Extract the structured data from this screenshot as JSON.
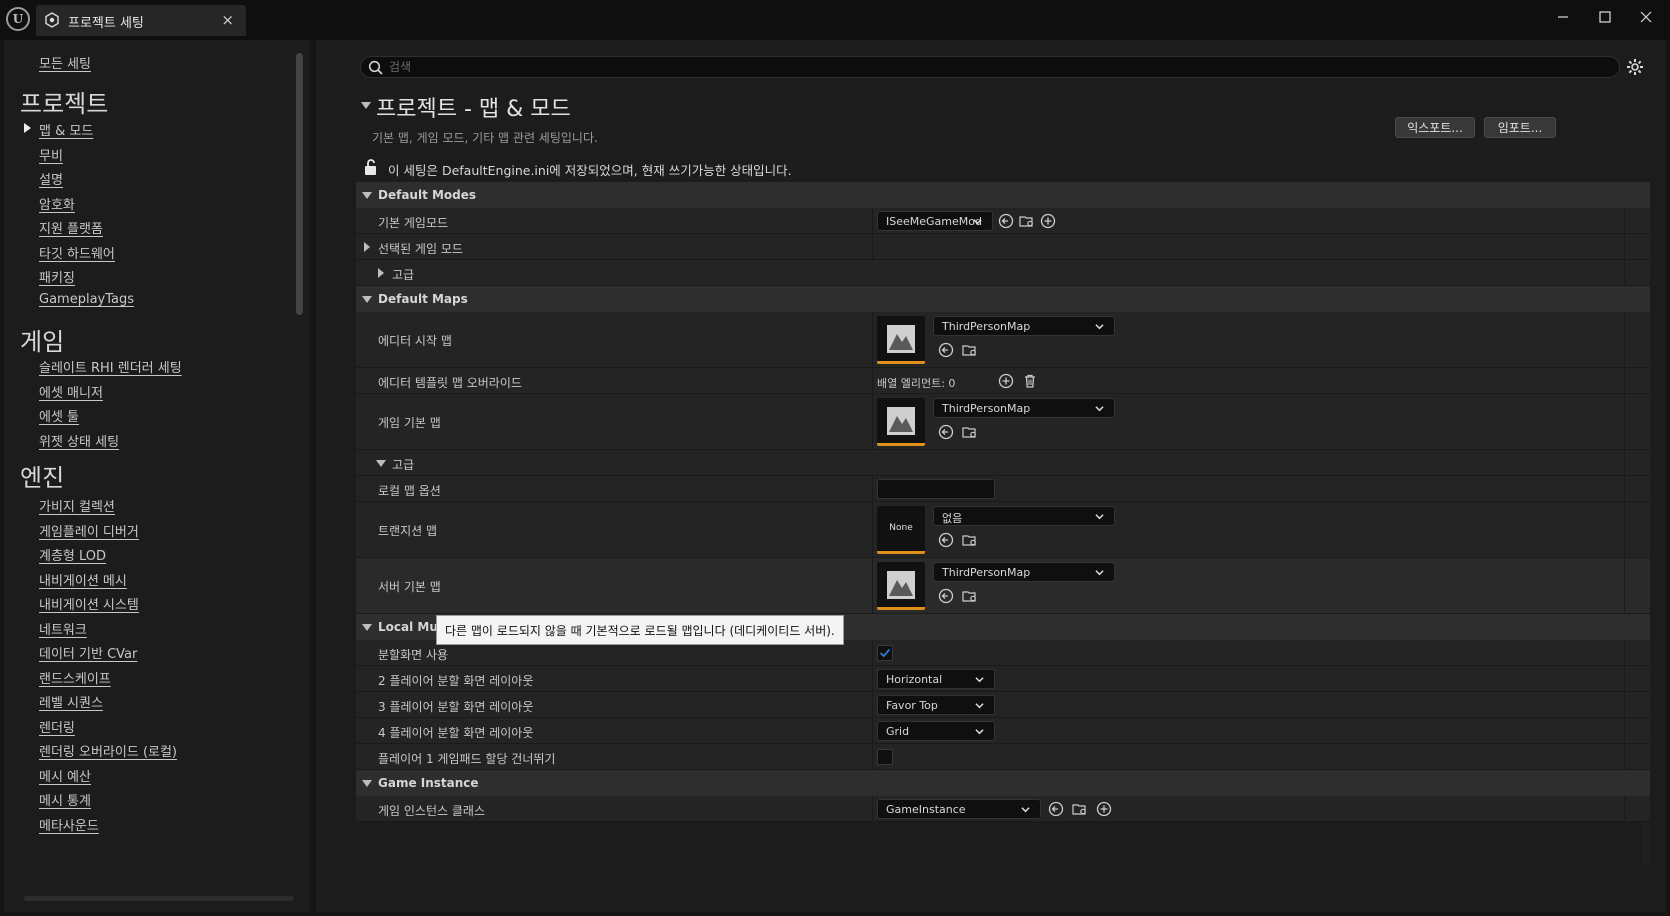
{
  "window": {
    "tab_title": "프로젝트 세팅",
    "tab_close": "×"
  },
  "sidebar": {
    "all_settings": "모든 세팅",
    "categories": [
      {
        "title": "프로젝트",
        "items": [
          "맵 & 모드",
          "무비",
          "설명",
          "암호화",
          "지원 플랫폼",
          "타깃 하드웨어",
          "패키징",
          "GameplayTags"
        ]
      },
      {
        "title": "게임",
        "items": [
          "슬레이트 RHI 렌더러 세팅",
          "에셋 매니저",
          "에셋 툴",
          "위젯 상태 세팅"
        ]
      },
      {
        "title": "엔진",
        "items": [
          "가비지 컬렉션",
          "게임플레이 디버거",
          "계층형 LOD",
          "내비게이션 메시",
          "내비게이션 시스템",
          "네트워크",
          "데이터 기반 CVar",
          "랜드스케이프",
          "레벨 시퀀스",
          "렌더링",
          "렌더링 오버라이드 (로컬)",
          "메시 예산",
          "메시 통계",
          "메타사운드"
        ]
      }
    ],
    "selected": "맵 & 모드"
  },
  "search": {
    "placeholder": "검색",
    "value": ""
  },
  "header": {
    "title": "프로젝트 - 맵 & 모드",
    "description": "기본 맵, 게임 모드, 기타 맵 관련 세팅입니다.",
    "export_label": "익스포트...",
    "import_label": "임포트...",
    "lock_notice": "이 세팅은 DefaultEngine.ini에 저장되었으며, 현재 쓰기가능한 상태입니다."
  },
  "sections": {
    "default_modes": {
      "title": "Default Modes",
      "default_gamemode_label": "기본 게임모드",
      "default_gamemode_value": "ISeeMeGameMod",
      "selected_gamemode_label": "선택된 게임 모드",
      "advanced_label": "고급"
    },
    "default_maps": {
      "title": "Default Maps",
      "editor_startup_label": "에디터 시작 맵",
      "editor_startup_value": "ThirdPersonMap",
      "editor_template_label": "에디터 템플릿 맵 오버라이드",
      "array_elements": "배열 엘리먼트: 0",
      "game_default_label": "게임 기본 맵",
      "game_default_value": "ThirdPersonMap",
      "advanced_label": "고급",
      "local_map_options_label": "로컬 맵 옵션",
      "local_map_options_value": "",
      "transition_map_label": "트랜지션 맵",
      "transition_map_value": "없음",
      "transition_thumb_text": "None",
      "server_default_label": "서버 기본 맵",
      "server_default_value": "ThirdPersonMap"
    },
    "local_multiplayer": {
      "title": "Local Multiplayer",
      "split_screen_label": "분할화면 사용",
      "split_screen_checked": true,
      "two_player_label": "2 플레이어 분할 화면 레이아웃",
      "two_player_value": "Horizontal",
      "three_player_label": "3 플레이어 분할 화면 레이아웃",
      "three_player_value": "Favor Top",
      "four_player_label": "4 플레이어 분할 화면 레이아웃",
      "four_player_value": "Grid",
      "skip_gamepad_label": "플레이어 1 게임패드 할당 건너뛰기",
      "skip_gamepad_checked": false
    },
    "game_instance": {
      "title": "Game Instance",
      "class_label": "게임 인스턴스 클래스",
      "class_value": "GameInstance"
    }
  },
  "tooltip": "다른 맵이 로드되지 않을 때 기본적으로 로드될 맵입니다 (데디케이티드 서버).",
  "colors": {
    "accent": "#e0901a",
    "checkbox_blue": "#2b7fd6"
  }
}
